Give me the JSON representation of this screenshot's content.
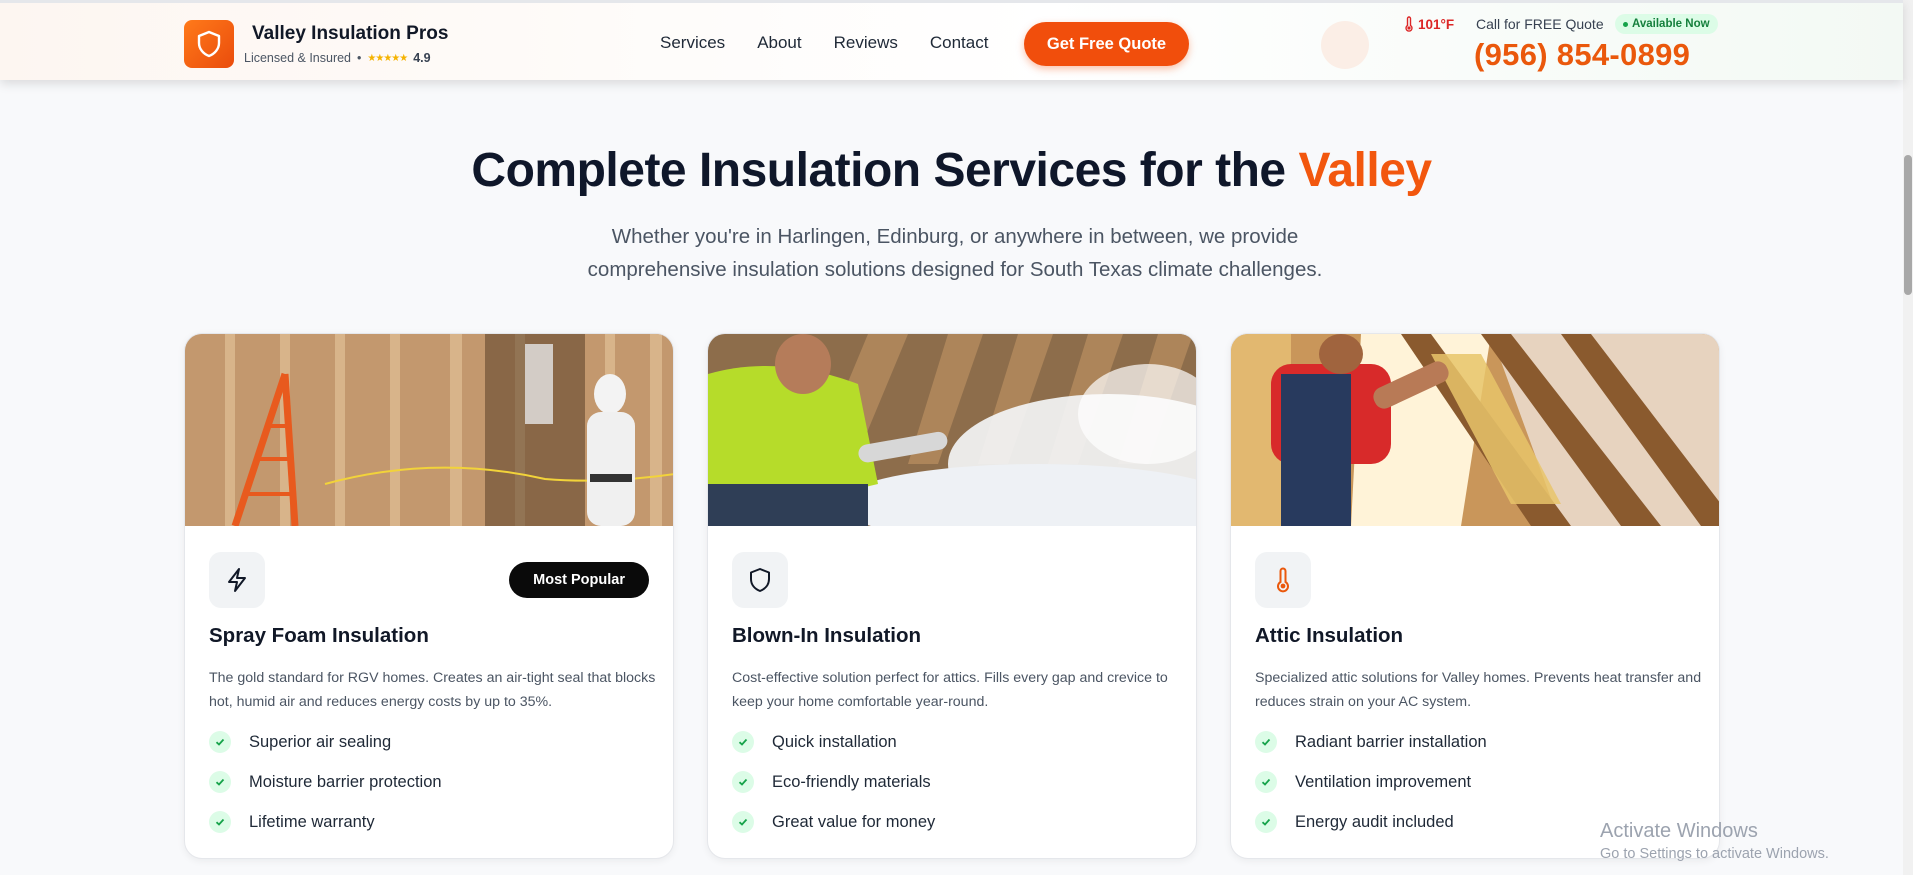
{
  "header": {
    "brand_name": "Valley Insulation Pros",
    "licensed": "Licensed & Insured",
    "separator": "•",
    "stars": "★★★★★",
    "rating": "4.9",
    "nav": [
      "Services",
      "About",
      "Reviews",
      "Contact"
    ],
    "quote_button": "Get Free Quote",
    "temperature": "101°F",
    "call_label": "Call for FREE Quote",
    "available": "Available Now",
    "phone": "(956) 854-0899"
  },
  "hero": {
    "title_main": "Complete Insulation Services for the ",
    "title_accent": "Valley",
    "subtitle": "Whether you're in Harlingen, Edinburg, or anywhere in between, we provide comprehensive insulation solutions designed for South Texas climate challenges."
  },
  "cards": [
    {
      "icon": "lightning-icon",
      "badge": "Most Popular",
      "title": "Spray Foam Insulation",
      "description": "The gold standard for RGV homes. Creates an air-tight seal that blocks hot, humid air and reduces energy costs by up to 35%.",
      "features": [
        "Superior air sealing",
        "Moisture barrier protection",
        "Lifetime warranty"
      ]
    },
    {
      "icon": "shield-icon",
      "title": "Blown-In Insulation",
      "description": "Cost-effective solution perfect for attics. Fills every gap and crevice to keep your home comfortable year-round.",
      "features": [
        "Quick installation",
        "Eco-friendly materials",
        "Great value for money"
      ]
    },
    {
      "icon": "thermometer-icon",
      "title": "Attic Insulation",
      "description": "Specialized attic solutions for Valley homes. Prevents heat transfer and reduces strain on your AC system.",
      "features": [
        "Radiant barrier installation",
        "Ventilation improvement",
        "Energy audit included"
      ]
    }
  ],
  "watermark": {
    "line1": "Activate Windows",
    "line2": "Go to Settings to activate Windows."
  },
  "colors": {
    "accent": "#f14e0c",
    "phone": "#ea580c",
    "success": "#16a34a",
    "dark": "#0f172a"
  }
}
